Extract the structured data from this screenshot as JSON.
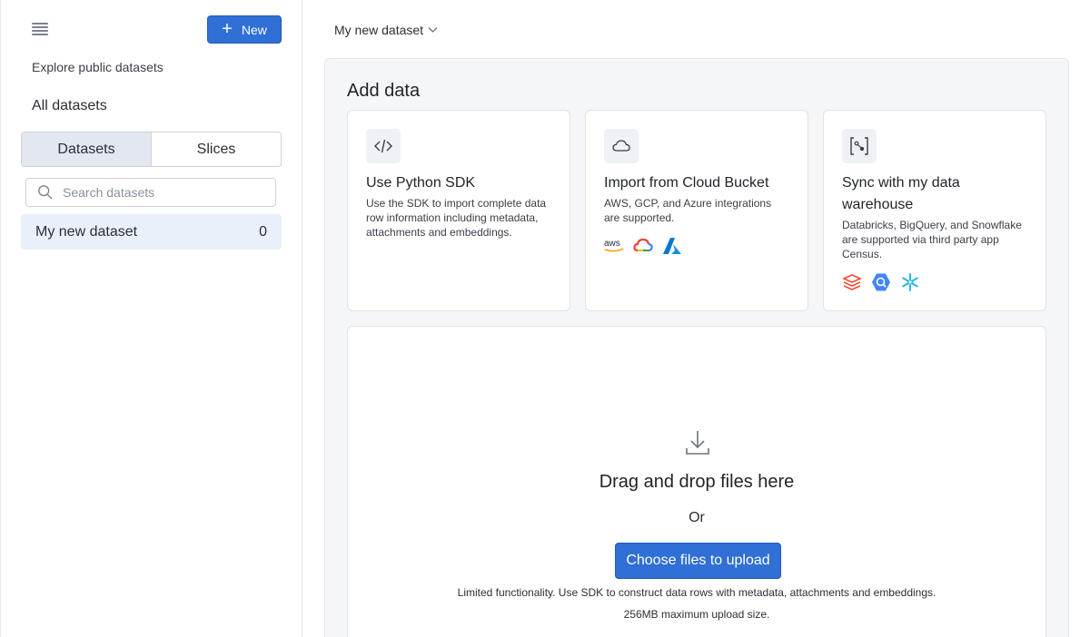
{
  "sidebar": {
    "new_label": "New",
    "explore_label": "Explore public datasets",
    "all_datasets_label": "All datasets",
    "segments": [
      "Datasets",
      "Slices"
    ],
    "search_placeholder": "Search datasets",
    "datasets": [
      {
        "name": "My new dataset",
        "count": "0"
      }
    ]
  },
  "header": {
    "dataset_name": "My new dataset"
  },
  "main": {
    "title": "Add data",
    "cards": [
      {
        "title": "Use Python SDK",
        "description": "Use the SDK to import complete data row information including metadata, attachments and embeddings.",
        "icon": "code-icon"
      },
      {
        "title": "Import from Cloud Bucket",
        "description": "AWS, GCP, and Azure integrations are supported.",
        "icon": "cloud-icon",
        "logos": [
          "aws-logo-icon",
          "gcp-logo-icon",
          "azure-logo-icon"
        ],
        "aws_text": "aws"
      },
      {
        "title": "Sync with my data warehouse",
        "description": "Databricks, BigQuery, and Snowflake are supported via third party app Census.",
        "icon": "data-warehouse-icon",
        "logos": [
          "databricks-logo-icon",
          "bigquery-logo-icon",
          "snowflake-logo-icon"
        ]
      }
    ],
    "dropzone": {
      "title": "Drag and drop files here",
      "or_text": "Or",
      "button_label": "Choose files to upload",
      "note": "Limited functionality. Use SDK to construct data rows with metadata, attachments and embeddings.",
      "size_limit": "256MB maximum upload size."
    }
  },
  "colors": {
    "primary": "#2f6fd6",
    "panel_bg": "#f5f6f8",
    "selected_bg": "#e9f0f9"
  }
}
